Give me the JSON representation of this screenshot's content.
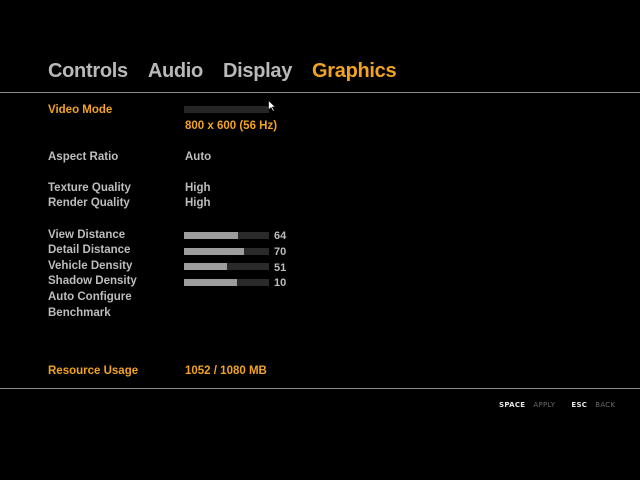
{
  "tabs": [
    {
      "label": "Controls",
      "active": false
    },
    {
      "label": "Audio",
      "active": false
    },
    {
      "label": "Display",
      "active": false
    },
    {
      "label": "Graphics",
      "active": true
    }
  ],
  "settings": {
    "video_mode": {
      "label": "Video Mode",
      "value": "800 x 600 (56 Hz)"
    },
    "aspect_ratio": {
      "label": "Aspect Ratio",
      "value": "Auto"
    },
    "texture_quality": {
      "label": "Texture Quality",
      "value": "High"
    },
    "render_quality": {
      "label": "Render Quality",
      "value": "High"
    },
    "view_distance": {
      "label": "View Distance",
      "value": "64",
      "level": 0.64
    },
    "detail_distance": {
      "label": "Detail Distance",
      "value": "70",
      "level": 0.7
    },
    "vehicle_density": {
      "label": "Vehicle Density",
      "value": "51",
      "level": 0.51
    },
    "shadow_density": {
      "label": "Shadow Density",
      "value": "10",
      "level": 0.625
    },
    "auto_configure": {
      "label": "Auto Configure"
    },
    "benchmark": {
      "label": "Benchmark"
    },
    "resource_usage": {
      "label": "Resource Usage",
      "value": "1052 / 1080 MB"
    }
  },
  "footer": {
    "space_key": "SPACE",
    "apply_label": "APPLY",
    "esc_key": "ESC",
    "back_label": "BACK"
  },
  "colors": {
    "accent": "#f2a321",
    "text": "#bdbdbd",
    "bar_fill": "#9d9d9d",
    "bar_track": "#2a2a2a",
    "divider": "#8c8c8c",
    "background": "#000000"
  },
  "icons": {
    "pointer": "mouse-pointer-icon"
  }
}
